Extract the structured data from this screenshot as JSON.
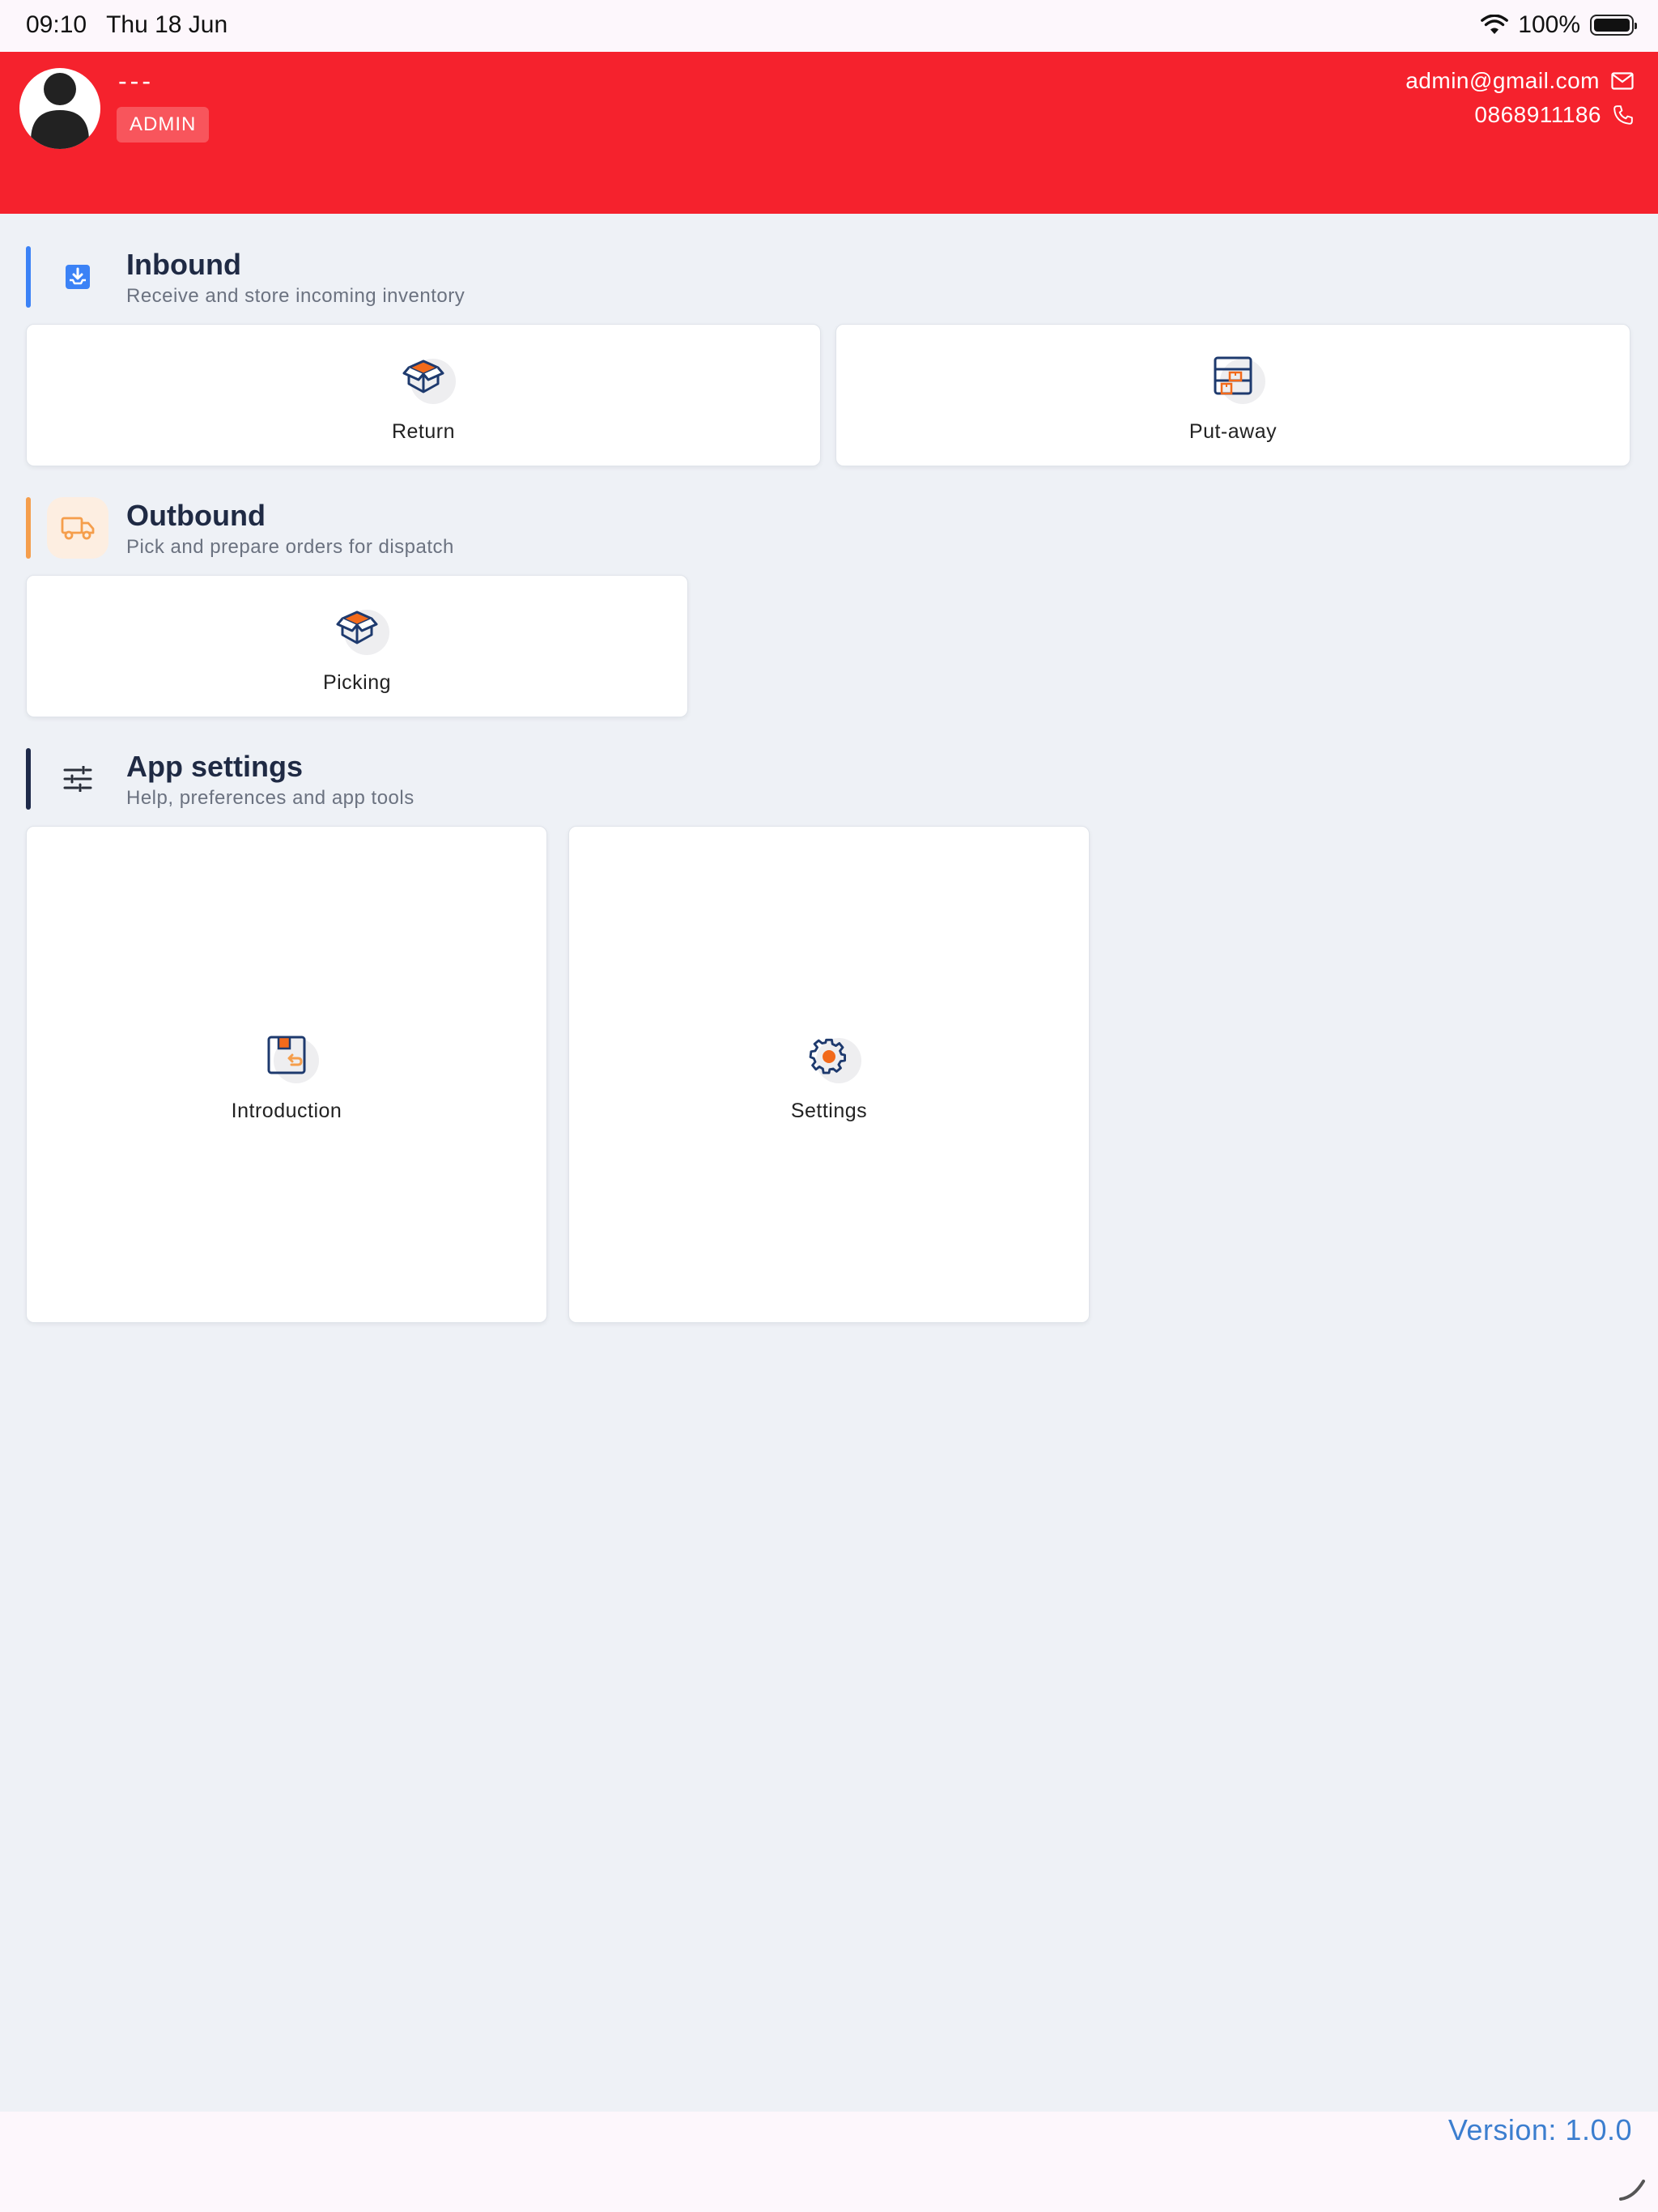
{
  "status_bar": {
    "time": "09:10",
    "date": "Thu 18 Jun",
    "battery": "100%"
  },
  "header": {
    "user_name": "---",
    "role": "ADMIN",
    "email": "admin@gmail.com",
    "phone": "0868911186",
    "color": "#f5222d"
  },
  "sections": [
    {
      "title": "Inbound",
      "subtitle": "Receive and store incoming inventory",
      "accent": "#3b82f6",
      "icon": "inbox-download-icon",
      "cards": [
        {
          "label": "Return",
          "icon": "box-icon"
        },
        {
          "label": "Put-away",
          "icon": "shelf-icon"
        }
      ]
    },
    {
      "title": "Outbound",
      "subtitle": "Pick and prepare orders for dispatch",
      "accent": "#f59e4c",
      "icon": "truck-icon",
      "cards": [
        {
          "label": "Picking",
          "icon": "box-icon"
        }
      ]
    },
    {
      "title": "App settings",
      "subtitle": "Help, preferences and app tools",
      "accent": "#1e2a4a",
      "icon": "sliders-icon",
      "cards": [
        {
          "label": "Introduction",
          "icon": "intro-icon"
        },
        {
          "label": "Settings",
          "icon": "gear-icon"
        }
      ]
    }
  ],
  "footer": {
    "version": "Version: 1.0.0"
  }
}
